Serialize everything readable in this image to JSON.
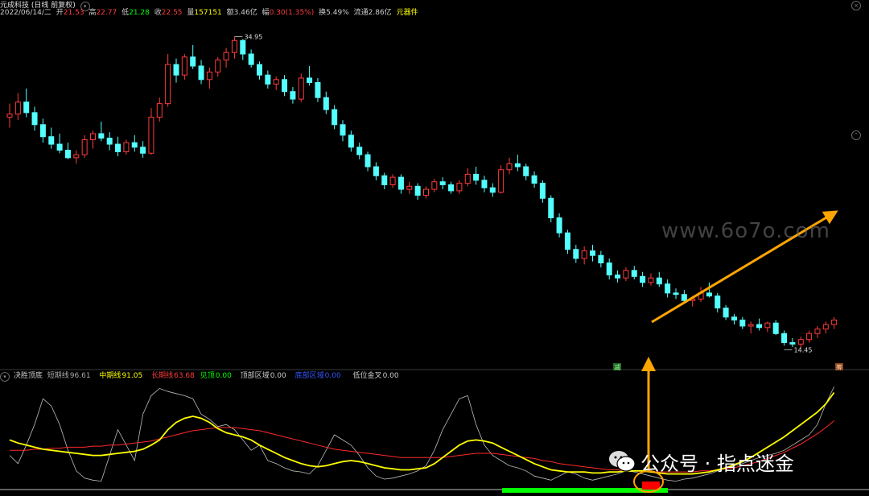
{
  "header": {
    "title": "元成科技 (日线 前复权)",
    "date": "2022/06/14/二",
    "open": {
      "label": "开",
      "value": "21.53"
    },
    "high": {
      "label": "高",
      "value": "22.77"
    },
    "low": {
      "label": "低",
      "value": "21.28"
    },
    "close": {
      "label": "收",
      "value": "22.55"
    },
    "volume": {
      "label": "量",
      "value": "157151"
    },
    "amount": {
      "label": "额",
      "value": "3.46亿"
    },
    "change": {
      "label": "幅",
      "value": "0.30(1.35%)"
    },
    "turnover": {
      "label": "换",
      "value": "5.49%"
    },
    "float": {
      "label": "流通",
      "value": "2.86亿"
    },
    "sector": "元器件"
  },
  "price_labels": {
    "high": "34.95",
    "low": "14.45"
  },
  "badges": {
    "left": "减",
    "right": "筹"
  },
  "indicator": {
    "name": "决胜顶底",
    "short": {
      "label": "短期线",
      "value": "96.61"
    },
    "mid": {
      "label": "中期线",
      "value": "91.05"
    },
    "long": {
      "label": "长期线",
      "value": "63.68"
    },
    "top": {
      "label": "见顶",
      "value": "0.00"
    },
    "top_zone": {
      "label": "顶部区域",
      "value": "0.00"
    },
    "bottom_zone": {
      "label": "底部区域",
      "value": "0.00"
    },
    "golden": {
      "label": "低位金叉",
      "value": "0.00"
    }
  },
  "watermark": "www.6o7o.com",
  "wechat": "公众号 · 指点迷金",
  "colors": {
    "up": "#ff3b3b",
    "down": "#54ffff",
    "yellow": "#ffff00",
    "green": "#00ff00",
    "orange": "#ffa500"
  },
  "chart_data": {
    "type": "candlestick",
    "series": [
      {
        "name": "K线",
        "ohlc": [
          [
            29.6,
            30.5,
            28.9,
            29.8
          ],
          [
            29.8,
            31.2,
            29.4,
            30.6
          ],
          [
            30.6,
            31.5,
            29.6,
            29.9
          ],
          [
            29.9,
            30.3,
            28.7,
            29.1
          ],
          [
            29.1,
            29.5,
            27.9,
            28.3
          ],
          [
            28.3,
            28.9,
            27.5,
            27.8
          ],
          [
            27.8,
            28.5,
            27.2,
            27.4
          ],
          [
            27.4,
            27.9,
            26.8,
            26.9
          ],
          [
            26.9,
            27.4,
            26.5,
            27.1
          ],
          [
            27.1,
            28.4,
            26.9,
            28.1
          ],
          [
            28.1,
            28.7,
            27.5,
            28.5
          ],
          [
            28.5,
            29.3,
            28.0,
            28.2
          ],
          [
            28.2,
            28.6,
            27.4,
            27.8
          ],
          [
            27.8,
            28.3,
            27.0,
            27.3
          ],
          [
            27.3,
            28.1,
            27.1,
            27.9
          ],
          [
            27.9,
            28.4,
            27.3,
            27.6
          ],
          [
            27.6,
            28.0,
            26.9,
            27.2
          ],
          [
            27.2,
            30.2,
            27.1,
            29.6
          ],
          [
            29.6,
            30.9,
            29.3,
            30.5
          ],
          [
            30.5,
            33.8,
            30.3,
            33.1
          ],
          [
            33.1,
            33.5,
            31.9,
            32.4
          ],
          [
            32.4,
            33.8,
            32.1,
            33.6
          ],
          [
            33.6,
            34.4,
            32.8,
            33.0
          ],
          [
            33.0,
            33.4,
            31.8,
            32.1
          ],
          [
            32.1,
            32.9,
            31.5,
            32.6
          ],
          [
            32.6,
            33.6,
            32.3,
            33.4
          ],
          [
            33.4,
            34.2,
            32.9,
            33.9
          ],
          [
            33.9,
            34.95,
            33.5,
            34.7
          ],
          [
            34.7,
            34.8,
            33.4,
            33.8
          ],
          [
            33.8,
            34.1,
            32.9,
            33.1
          ],
          [
            33.1,
            33.3,
            32.1,
            32.4
          ],
          [
            32.4,
            32.7,
            31.5,
            31.8
          ],
          [
            31.8,
            32.3,
            31.4,
            32.1
          ],
          [
            32.1,
            32.4,
            31.0,
            31.3
          ],
          [
            31.3,
            31.6,
            30.5,
            30.8
          ],
          [
            30.8,
            32.5,
            30.6,
            32.2
          ],
          [
            32.2,
            33.0,
            31.7,
            31.9
          ],
          [
            31.9,
            32.2,
            30.6,
            30.9
          ],
          [
            30.9,
            31.3,
            29.8,
            30.1
          ],
          [
            30.1,
            30.4,
            28.8,
            29.1
          ],
          [
            29.1,
            29.4,
            28.0,
            28.4
          ],
          [
            28.4,
            28.7,
            27.3,
            27.6
          ],
          [
            27.6,
            27.9,
            26.8,
            27.1
          ],
          [
            27.1,
            27.3,
            26.0,
            26.3
          ],
          [
            26.3,
            26.6,
            25.4,
            25.7
          ],
          [
            25.7,
            25.9,
            24.8,
            25.1
          ],
          [
            25.1,
            25.8,
            24.9,
            25.6
          ],
          [
            25.6,
            25.8,
            24.5,
            24.8
          ],
          [
            24.8,
            25.3,
            24.5,
            25.0
          ],
          [
            25.0,
            25.2,
            24.1,
            24.4
          ],
          [
            24.4,
            25.0,
            24.2,
            24.8
          ],
          [
            24.8,
            25.5,
            24.6,
            25.3
          ],
          [
            25.3,
            25.6,
            24.8,
            25.1
          ],
          [
            25.1,
            25.3,
            24.5,
            24.7
          ],
          [
            24.7,
            25.4,
            24.5,
            25.2
          ],
          [
            25.2,
            26.2,
            25.0,
            25.8
          ],
          [
            25.8,
            26.3,
            25.1,
            25.4
          ],
          [
            25.4,
            25.7,
            24.6,
            24.9
          ],
          [
            24.9,
            25.2,
            24.3,
            24.6
          ],
          [
            24.6,
            26.4,
            24.5,
            26.1
          ],
          [
            26.1,
            26.9,
            25.8,
            26.5
          ],
          [
            26.5,
            27.1,
            26.0,
            26.3
          ],
          [
            26.3,
            26.5,
            25.4,
            25.7
          ],
          [
            25.7,
            26.0,
            24.9,
            25.2
          ],
          [
            25.2,
            25.4,
            23.9,
            24.2
          ],
          [
            24.2,
            24.4,
            22.6,
            22.9
          ],
          [
            22.9,
            23.2,
            21.6,
            21.9
          ],
          [
            21.9,
            22.1,
            20.5,
            20.8
          ],
          [
            20.8,
            21.1,
            19.9,
            20.2
          ],
          [
            20.2,
            21.0,
            19.8,
            20.7
          ],
          [
            20.7,
            21.1,
            20.0,
            20.4
          ],
          [
            20.4,
            20.7,
            19.6,
            19.9
          ],
          [
            19.9,
            20.2,
            18.8,
            19.1
          ],
          [
            19.1,
            19.4,
            18.6,
            18.9
          ],
          [
            18.9,
            19.6,
            18.7,
            19.4
          ],
          [
            19.4,
            19.7,
            18.8,
            19.0
          ],
          [
            19.0,
            19.3,
            18.3,
            18.6
          ],
          [
            18.6,
            19.2,
            18.4,
            18.9
          ],
          [
            18.9,
            19.3,
            18.3,
            18.5
          ],
          [
            18.5,
            18.8,
            17.6,
            17.9
          ],
          [
            17.9,
            18.2,
            17.5,
            17.8
          ],
          [
            17.8,
            18.1,
            17.2,
            17.4
          ],
          [
            17.4,
            17.7,
            17.0,
            17.5
          ],
          [
            17.5,
            18.3,
            17.3,
            17.9
          ],
          [
            17.9,
            18.6,
            17.6,
            17.7
          ],
          [
            17.7,
            17.9,
            16.6,
            16.9
          ],
          [
            16.9,
            17.1,
            16.1,
            16.3
          ],
          [
            16.3,
            16.5,
            15.8,
            16.1
          ],
          [
            16.1,
            16.3,
            15.5,
            15.7
          ],
          [
            15.7,
            16.0,
            15.2,
            15.8
          ],
          [
            15.8,
            16.2,
            15.4,
            15.6
          ],
          [
            15.6,
            16.0,
            15.3,
            15.9
          ],
          [
            15.9,
            16.1,
            15.1,
            15.2
          ],
          [
            15.2,
            15.4,
            14.4,
            14.6
          ],
          [
            14.6,
            14.9,
            14.3,
            14.5
          ],
          [
            14.5,
            15.0,
            14.2,
            14.8
          ],
          [
            14.8,
            15.4,
            14.6,
            15.2
          ],
          [
            15.2,
            15.7,
            14.9,
            15.5
          ],
          [
            15.5,
            16.0,
            15.2,
            15.8
          ],
          [
            15.8,
            16.3,
            15.5,
            16.1
          ]
        ]
      },
      {
        "name": "短期线",
        "values": [
          30,
          22,
          40,
          60,
          85,
          78,
          60,
          35,
          15,
          8,
          6,
          5,
          30,
          55,
          40,
          25,
          70,
          88,
          95,
          92,
          90,
          88,
          85,
          70,
          65,
          58,
          60,
          55,
          45,
          35,
          40,
          25,
          22,
          18,
          15,
          14,
          12,
          20,
          35,
          50,
          45,
          40,
          30,
          18,
          10,
          7,
          8,
          10,
          12,
          15,
          20,
          35,
          55,
          70,
          85,
          88,
          60,
          40,
          30,
          25,
          20,
          18,
          15,
          10,
          8,
          6,
          10,
          14,
          12,
          8,
          6,
          8,
          10,
          12,
          15,
          14,
          12,
          10,
          8,
          6,
          5,
          7,
          8,
          10,
          12,
          15,
          18,
          20,
          22,
          25,
          28,
          30,
          32,
          35,
          40,
          45,
          50,
          60,
          80,
          96.61
        ]
      },
      {
        "name": "中期线",
        "values": [
          45,
          42,
          40,
          38,
          36,
          35,
          34,
          33,
          32,
          31,
          30,
          30,
          31,
          32,
          33,
          34,
          36,
          40,
          45,
          55,
          62,
          66,
          68,
          66,
          62,
          56,
          52,
          50,
          48,
          45,
          40,
          36,
          32,
          28,
          25,
          22,
          20,
          19,
          20,
          22,
          24,
          25,
          24,
          22,
          20,
          18,
          17,
          16,
          16,
          17,
          18,
          22,
          28,
          34,
          40,
          44,
          45,
          44,
          42,
          38,
          34,
          30,
          26,
          22,
          19,
          16,
          15,
          14,
          14,
          14,
          13,
          13,
          14,
          14,
          15,
          15,
          15,
          14,
          13,
          12,
          12,
          12,
          12,
          13,
          14,
          16,
          18,
          21,
          24,
          28,
          33,
          38,
          43,
          48,
          54,
          60,
          66,
          72,
          80,
          91.05
        ]
      },
      {
        "name": "长期线",
        "values": [
          35,
          35,
          35,
          36,
          36,
          37,
          37,
          38,
          38,
          38,
          39,
          39,
          40,
          40,
          41,
          42,
          43,
          44,
          46,
          48,
          50,
          52,
          54,
          55,
          56,
          57,
          57,
          57,
          56,
          55,
          54,
          52,
          50,
          48,
          46,
          44,
          42,
          40,
          38,
          36,
          35,
          34,
          33,
          32,
          31,
          30,
          29,
          28,
          28,
          28,
          28,
          28,
          28,
          29,
          30,
          31,
          32,
          32,
          32,
          31,
          30,
          29,
          28,
          27,
          25,
          24,
          22,
          21,
          20,
          19,
          18,
          17,
          16,
          16,
          15,
          15,
          15,
          14,
          14,
          14,
          14,
          14,
          14,
          15,
          15,
          16,
          17,
          18,
          20,
          22,
          24,
          27,
          30,
          33,
          37,
          41,
          46,
          51,
          57,
          63.68
        ]
      }
    ],
    "main_ylim": [
      13.5,
      36.0
    ],
    "ind_ylim": [
      0,
      100
    ]
  }
}
